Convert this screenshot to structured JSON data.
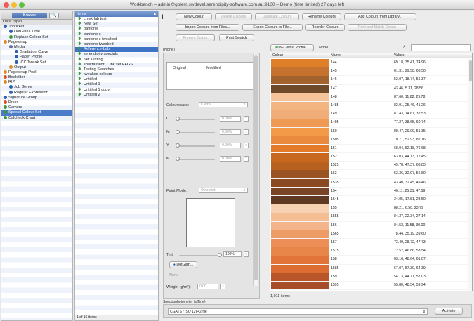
{
  "window": {
    "title": "Workbench – admin@golem.swdevel.serendipity-software.com.au:9100 – Demo (time limited) 27 days left"
  },
  "colors": {
    "selection": "#3e73c6",
    "header_blue": "#5a80c0",
    "green_item": "#3a9a3a"
  },
  "nav": {
    "tab_browse": "Browse",
    "header": "Data Types",
    "items": [
      {
        "label": "Jobticket",
        "icon": "jobticket-icon",
        "color": "#2b5fb0",
        "indent": 0
      },
      {
        "label": "DotGain Curve",
        "icon": "dotgain-icon",
        "color": "#2b5fb0",
        "indent": 1
      },
      {
        "label": "Replace Colour Set",
        "icon": "replace-icon",
        "color": "#3a9a3a",
        "indent": 1
      },
      {
        "label": "Pagesetup",
        "icon": "pagesetup-icon",
        "color": "#e08a20",
        "indent": 0
      },
      {
        "label": "Media",
        "icon": "media-icon",
        "color": "#6b6b9a",
        "indent": 1
      },
      {
        "label": "Gradation Curve",
        "icon": "gradation-icon",
        "color": "#2b5fb0",
        "indent": 2
      },
      {
        "label": "Paper Profile",
        "icon": "paper-icon",
        "color": "#2b5fb0",
        "indent": 2
      },
      {
        "label": "ICC Tweak Set",
        "icon": "icc-icon",
        "color": "#2b5fb0",
        "indent": 2
      },
      {
        "label": "Output",
        "icon": "output-icon",
        "color": "#e08a20",
        "indent": 1
      },
      {
        "label": "Pagesetup Pool",
        "icon": "pool-icon",
        "color": "#e08a20",
        "indent": 0
      },
      {
        "label": "Bookfilter",
        "icon": "bookfilter-icon",
        "color": "#e05020",
        "indent": 0
      },
      {
        "label": "RIP",
        "icon": "rip-icon",
        "color": "#e08a20",
        "indent": 0
      },
      {
        "label": "Job Genie",
        "icon": "genie-icon",
        "color": "#2b5fb0",
        "indent": 1
      },
      {
        "label": "Regular Expression",
        "icon": "regex-icon",
        "color": "#2b5fb0",
        "indent": 1
      },
      {
        "label": "Signature Group",
        "icon": "signature-icon",
        "color": "#2b5fb0",
        "indent": 0
      },
      {
        "label": "Press",
        "icon": "press-icon",
        "color": "#e05020",
        "indent": 0
      },
      {
        "label": "Camera",
        "icon": "camera-icon",
        "color": "#3a9a3a",
        "indent": 0
      },
      {
        "label": "Special Colour Set",
        "icon": "special-colour-icon",
        "color": "#3a9a3a",
        "indent": 0,
        "selected": true
      },
      {
        "label": "Calcheck Chart",
        "icon": "calcheck-icon",
        "color": "#3a9a3a",
        "indent": 0
      }
    ]
  },
  "items": {
    "header": "Items",
    "list": [
      "cmyk lab test",
      "New Set",
      "pantone",
      "pantone c",
      "pantone c tweaked",
      "pantone tweaked",
      "Reference-Lab",
      "serendipity specials",
      "Set Testing",
      "spektassilor ... ink set FFGS",
      "Testing Swatches",
      "tweaked colours",
      "Untitled",
      "Untitled 1",
      "Untitled 1 copy",
      "Untitled 2"
    ],
    "selected_index": 6,
    "count_label": "1 of 16 items"
  },
  "toolbar": {
    "row1": [
      {
        "label": "New Colour",
        "enabled": true
      },
      {
        "label": "Delete Colours",
        "enabled": false
      },
      {
        "label": "Duplicate Colours",
        "enabled": false
      },
      {
        "label": "Rename Colours",
        "enabled": true
      },
      {
        "label": "Add Colours from Library...",
        "enabled": true
      }
    ],
    "row2": [
      {
        "label": "Import Colours from Files...",
        "enabled": true
      },
      {
        "label": "Export Colours to File...",
        "enabled": true
      },
      {
        "label": "Reorder Colours",
        "enabled": true
      },
      {
        "label": "Print and Match Colour",
        "enabled": false
      }
    ],
    "row3": [
      {
        "label": "Present Colour",
        "enabled": false
      },
      {
        "label": "Print Swatch",
        "enabled": true
      }
    ]
  },
  "section_label": "(None)",
  "editor": {
    "original": "Original",
    "modified": "Modified",
    "colourspace_label": "Colourspace:",
    "colourspace_value": "CMYK",
    "channels": [
      {
        "name": "C",
        "value": "0.00%"
      },
      {
        "name": "M",
        "value": "0.00%"
      },
      {
        "name": "Y",
        "value": "0.00%"
      },
      {
        "name": "K",
        "value": "0.00%"
      }
    ],
    "paint_mode_label": "Paint Mode:",
    "paint_mode_value": "Overprint",
    "tint_label": "Tint:",
    "tint_value": "100%",
    "dotgain_button": "DotGain...",
    "dotgain_value": "None",
    "weight_label": "Weight (g/m²):",
    "weight_value": "0.00"
  },
  "ncolour": {
    "button": "N-Colour Profile...",
    "value": "None",
    "search_placeholder": ""
  },
  "table": {
    "headers": [
      "Colour",
      "Name",
      "Values"
    ],
    "rows": [
      {
        "swatch": "#e07f2a",
        "name": "144",
        "values": "69.18, 35.41, 74.96"
      },
      {
        "swatch": "#c4722e",
        "name": "145",
        "values": "61.31, 29.58, 66.50"
      },
      {
        "swatch": "#a2622e",
        "name": "146",
        "values": "52.07, 18.74, 55.37"
      },
      {
        "swatch": "#6e4a2a",
        "name": "147",
        "values": "43.46, 5.31, 28.56"
      },
      {
        "swatch": "#f6c49a",
        "name": "148",
        "values": "87.60, 11.82, 29.78"
      },
      {
        "swatch": "#f3b582",
        "name": "1485",
        "values": "82.91, 25.46, 41.26"
      },
      {
        "swatch": "#f0ad78",
        "name": "149",
        "values": "87.43, 14.61, 32.53"
      },
      {
        "swatch": "#ee9a55",
        "name": "1495",
        "values": "77.27, 38.65, 60.74"
      },
      {
        "swatch": "#f29a48",
        "name": "150",
        "values": "80.47, 29.09, 51.35"
      },
      {
        "swatch": "#ea8a3e",
        "name": "1505",
        "values": "70.71, 52.93, 82.76"
      },
      {
        "swatch": "#e27a2a",
        "name": "151",
        "values": "68.94, 52.18, 76.68"
      },
      {
        "swatch": "#c8681e",
        "name": "152",
        "values": "63.03, 44.13, 72.45"
      },
      {
        "swatch": "#b8601e",
        "name": "1525",
        "values": "49.78, 47.37, 68.85"
      },
      {
        "swatch": "#9a5424",
        "name": "153",
        "values": "53.36, 32.97, 56.80"
      },
      {
        "swatch": "#8a4b22",
        "name": "1535",
        "values": "43.40, 32.45, 49.46"
      },
      {
        "swatch": "#7a4426",
        "name": "154",
        "values": "46.11, 25.31, 47.59"
      },
      {
        "swatch": "#5e3a24",
        "name": "1545",
        "values": "34.05, 17.51, 28.50"
      },
      {
        "swatch": "#f7d2b2",
        "name": "155",
        "values": "88.21, 6.50, 23.79"
      },
      {
        "swatch": "#f4bd92",
        "name": "1555",
        "values": "84.37, 22.34, 27.14"
      },
      {
        "swatch": "#f2b488",
        "name": "156",
        "values": "84.52, 11.58, 30.00"
      },
      {
        "swatch": "#ee9c66",
        "name": "1565",
        "values": "78.44, 35.19, 39.60"
      },
      {
        "swatch": "#ec8e55",
        "name": "157",
        "values": "73.49, 28.72, 47.73"
      },
      {
        "swatch": "#e8864a",
        "name": "1575",
        "values": "72.52, 46.86, 53.54"
      },
      {
        "swatch": "#e2743a",
        "name": "158",
        "values": "63.16, 48.64, 61.87"
      },
      {
        "swatch": "#dc6c32",
        "name": "1585",
        "values": "67.07, 57.30, 64.39"
      },
      {
        "swatch": "#b8562a",
        "name": "159",
        "values": "54.13, 44.71, 57.03"
      },
      {
        "swatch": "#a64e28",
        "name": "1595",
        "values": "55.80, 48.54, 59.94"
      }
    ],
    "count_label": "1,011 items"
  },
  "spectro": {
    "label": "Spectrophotometer (offline)",
    "device": "CGATS / ISO 12642 file",
    "activate": "Activate"
  }
}
